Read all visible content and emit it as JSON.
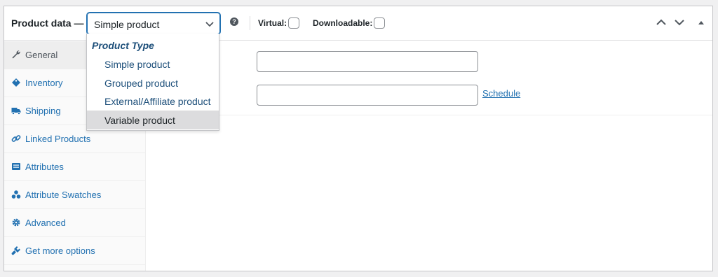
{
  "header": {
    "title": "Product data —",
    "selected_type": "Simple product",
    "help_icon": "question-circle-icon",
    "virtual_label": "Virtual:",
    "downloadable_label": "Downloadable:",
    "move_up_icon": "chevron-up-icon",
    "move_down_icon": "chevron-down-icon",
    "toggle_icon": "triangle-up-icon"
  },
  "dropdown": {
    "group_label": "Product Type",
    "options": [
      "Simple product",
      "Grouped product",
      "External/Affiliate product",
      "Variable product"
    ],
    "highlighted": "Variable product"
  },
  "tabs": [
    {
      "label": "General",
      "icon": "wrench-icon",
      "active": true
    },
    {
      "label": "Inventory",
      "icon": "tag-icon",
      "active": false
    },
    {
      "label": "Shipping",
      "icon": "truck-icon",
      "active": false
    },
    {
      "label": "Linked Products",
      "icon": "link-icon",
      "active": false
    },
    {
      "label": "Attributes",
      "icon": "list-icon",
      "active": false
    },
    {
      "label": "Attribute Swatches",
      "icon": "swatches-icon",
      "active": false
    },
    {
      "label": "Advanced",
      "icon": "gear-icon",
      "active": false
    },
    {
      "label": "Get more options",
      "icon": "plugin-icon",
      "active": false
    }
  ],
  "general": {
    "schedule_link": "Schedule"
  },
  "colors": {
    "accent": "#2271b1",
    "dropdown_text": "#1d4f7a",
    "highlight_bg": "#dcdcde"
  }
}
